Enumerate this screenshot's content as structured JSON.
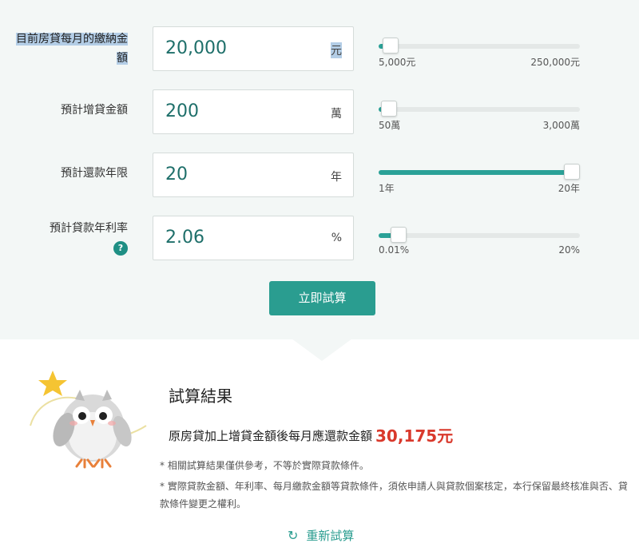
{
  "rows": [
    {
      "label": "目前房貸每月的繳納金額",
      "value": "20,000",
      "unit": "元",
      "min": "5,000元",
      "max": "250,000元",
      "fraction": 0.06
    },
    {
      "label": "預計增貸金額",
      "value": "200",
      "unit": "萬",
      "min": "50萬",
      "max": "3,000萬",
      "fraction": 0.05
    },
    {
      "label": "預計還款年限",
      "value": "20",
      "unit": "年",
      "min": "1年",
      "max": "20年",
      "fraction": 1.0
    },
    {
      "label": "預計貸款年利率",
      "value": "2.06",
      "unit": "%",
      "min": "0.01%",
      "max": "20%",
      "fraction": 0.1,
      "help": "?"
    }
  ],
  "calc_button": "立即試算",
  "result": {
    "title": "試算結果",
    "line_prefix": "原房貸加上增貸金額後每月應還款金額",
    "amount": "30,175元",
    "note1": "* 相關試算結果僅供參考，不等於實際貸款條件。",
    "note2": "* 實際貸款金額、年利率、每月繳款金額等貸款條件，須依申請人與貸款個案核定，本行保留最終核准與否、貸款條件變更之權利。",
    "reset_label": "重新試算"
  },
  "colors": {
    "accent": "#2a9d90",
    "amount": "#d9392c",
    "bg": "#f3f7f6"
  },
  "icons": {
    "help": "question-icon",
    "reset": "refresh-icon"
  }
}
